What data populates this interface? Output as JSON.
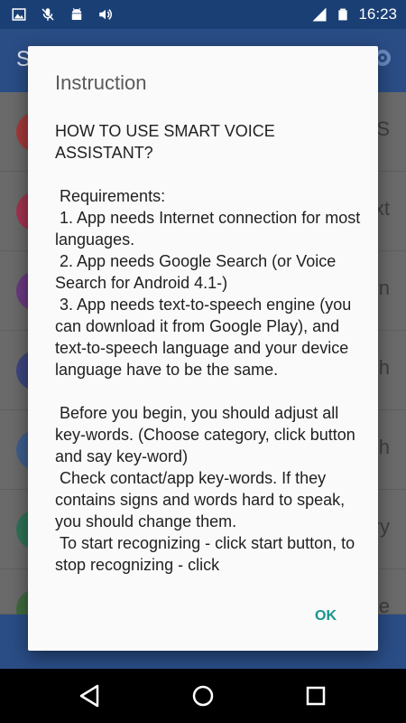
{
  "status_bar": {
    "time": "16:23",
    "icons": [
      "image-icon",
      "mic-off-icon",
      "android-icon",
      "volume-icon",
      "signal-icon",
      "battery-icon"
    ]
  },
  "background_app": {
    "title_fragment": "S",
    "row_fragments": [
      "S",
      "xt",
      "n",
      "h",
      "h",
      "ry",
      "e"
    ],
    "row_colors": [
      "#a33a3a",
      "#a3334f",
      "#6a3a80",
      "#3c4680",
      "#3d5e8c",
      "#2e7256",
      "#3f6a3f"
    ]
  },
  "dialog": {
    "title": "Instruction",
    "body": "HOW TO USE SMART VOICE ASSISTANT?\n\n Requirements:\n 1. App needs Internet connection for most languages.\n 2. App needs Google Search (or Voice Search for Android 4.1-)\n 3. App needs text-to-speech engine (you can download it from Google Play), and text-to-speech language and your device language have to be the same.\n\n Before you begin, you should adjust all key-words. (Choose category, click button and say key-word)\n Check contact/app key-words. If they contains signs and words hard to speak, you should change them.\n To start recognizing - click start button, to stop recognizing - click",
    "ok_label": "OK"
  },
  "colors": {
    "accent": "#15968c",
    "status_bar": "#1a3f75",
    "app_bar": "#2a4d86"
  }
}
